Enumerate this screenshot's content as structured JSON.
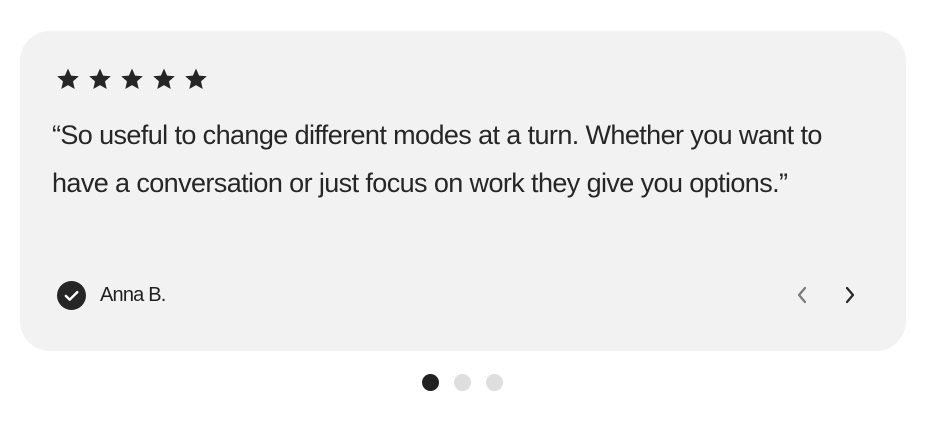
{
  "testimonial": {
    "rating": 5,
    "rating_max": 5,
    "quote": "“So useful to change different modes at a turn. Whether you want to have a conversation or just focus on work they give you options.”",
    "author_name": "Anna B.",
    "verified_icon": "check-circle-icon"
  },
  "navigation": {
    "prev_icon": "chevron-left-icon",
    "next_icon": "chevron-right-icon"
  },
  "pagination": {
    "count": 3,
    "active_index": 0
  },
  "colors": {
    "card_background": "#f2f2f2",
    "text": "#262626",
    "star": "#262626",
    "dot_active": "#222222",
    "dot_inactive": "#dedede",
    "arrow_prev": "#7a7a7a",
    "arrow_next": "#262626"
  }
}
